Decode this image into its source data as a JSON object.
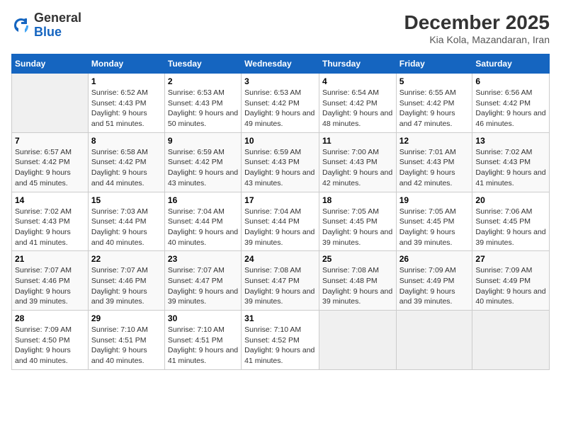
{
  "header": {
    "logo_general": "General",
    "logo_blue": "Blue",
    "title": "December 2025",
    "subtitle": "Kia Kola, Mazandaran, Iran"
  },
  "weekdays": [
    "Sunday",
    "Monday",
    "Tuesday",
    "Wednesday",
    "Thursday",
    "Friday",
    "Saturday"
  ],
  "weeks": [
    [
      {
        "num": "",
        "sunrise": "",
        "sunset": "",
        "daylight": ""
      },
      {
        "num": "1",
        "sunrise": "Sunrise: 6:52 AM",
        "sunset": "Sunset: 4:43 PM",
        "daylight": "Daylight: 9 hours and 51 minutes."
      },
      {
        "num": "2",
        "sunrise": "Sunrise: 6:53 AM",
        "sunset": "Sunset: 4:43 PM",
        "daylight": "Daylight: 9 hours and 50 minutes."
      },
      {
        "num": "3",
        "sunrise": "Sunrise: 6:53 AM",
        "sunset": "Sunset: 4:42 PM",
        "daylight": "Daylight: 9 hours and 49 minutes."
      },
      {
        "num": "4",
        "sunrise": "Sunrise: 6:54 AM",
        "sunset": "Sunset: 4:42 PM",
        "daylight": "Daylight: 9 hours and 48 minutes."
      },
      {
        "num": "5",
        "sunrise": "Sunrise: 6:55 AM",
        "sunset": "Sunset: 4:42 PM",
        "daylight": "Daylight: 9 hours and 47 minutes."
      },
      {
        "num": "6",
        "sunrise": "Sunrise: 6:56 AM",
        "sunset": "Sunset: 4:42 PM",
        "daylight": "Daylight: 9 hours and 46 minutes."
      }
    ],
    [
      {
        "num": "7",
        "sunrise": "Sunrise: 6:57 AM",
        "sunset": "Sunset: 4:42 PM",
        "daylight": "Daylight: 9 hours and 45 minutes."
      },
      {
        "num": "8",
        "sunrise": "Sunrise: 6:58 AM",
        "sunset": "Sunset: 4:42 PM",
        "daylight": "Daylight: 9 hours and 44 minutes."
      },
      {
        "num": "9",
        "sunrise": "Sunrise: 6:59 AM",
        "sunset": "Sunset: 4:42 PM",
        "daylight": "Daylight: 9 hours and 43 minutes."
      },
      {
        "num": "10",
        "sunrise": "Sunrise: 6:59 AM",
        "sunset": "Sunset: 4:43 PM",
        "daylight": "Daylight: 9 hours and 43 minutes."
      },
      {
        "num": "11",
        "sunrise": "Sunrise: 7:00 AM",
        "sunset": "Sunset: 4:43 PM",
        "daylight": "Daylight: 9 hours and 42 minutes."
      },
      {
        "num": "12",
        "sunrise": "Sunrise: 7:01 AM",
        "sunset": "Sunset: 4:43 PM",
        "daylight": "Daylight: 9 hours and 42 minutes."
      },
      {
        "num": "13",
        "sunrise": "Sunrise: 7:02 AM",
        "sunset": "Sunset: 4:43 PM",
        "daylight": "Daylight: 9 hours and 41 minutes."
      }
    ],
    [
      {
        "num": "14",
        "sunrise": "Sunrise: 7:02 AM",
        "sunset": "Sunset: 4:43 PM",
        "daylight": "Daylight: 9 hours and 41 minutes."
      },
      {
        "num": "15",
        "sunrise": "Sunrise: 7:03 AM",
        "sunset": "Sunset: 4:44 PM",
        "daylight": "Daylight: 9 hours and 40 minutes."
      },
      {
        "num": "16",
        "sunrise": "Sunrise: 7:04 AM",
        "sunset": "Sunset: 4:44 PM",
        "daylight": "Daylight: 9 hours and 40 minutes."
      },
      {
        "num": "17",
        "sunrise": "Sunrise: 7:04 AM",
        "sunset": "Sunset: 4:44 PM",
        "daylight": "Daylight: 9 hours and 39 minutes."
      },
      {
        "num": "18",
        "sunrise": "Sunrise: 7:05 AM",
        "sunset": "Sunset: 4:45 PM",
        "daylight": "Daylight: 9 hours and 39 minutes."
      },
      {
        "num": "19",
        "sunrise": "Sunrise: 7:05 AM",
        "sunset": "Sunset: 4:45 PM",
        "daylight": "Daylight: 9 hours and 39 minutes."
      },
      {
        "num": "20",
        "sunrise": "Sunrise: 7:06 AM",
        "sunset": "Sunset: 4:45 PM",
        "daylight": "Daylight: 9 hours and 39 minutes."
      }
    ],
    [
      {
        "num": "21",
        "sunrise": "Sunrise: 7:07 AM",
        "sunset": "Sunset: 4:46 PM",
        "daylight": "Daylight: 9 hours and 39 minutes."
      },
      {
        "num": "22",
        "sunrise": "Sunrise: 7:07 AM",
        "sunset": "Sunset: 4:46 PM",
        "daylight": "Daylight: 9 hours and 39 minutes."
      },
      {
        "num": "23",
        "sunrise": "Sunrise: 7:07 AM",
        "sunset": "Sunset: 4:47 PM",
        "daylight": "Daylight: 9 hours and 39 minutes."
      },
      {
        "num": "24",
        "sunrise": "Sunrise: 7:08 AM",
        "sunset": "Sunset: 4:47 PM",
        "daylight": "Daylight: 9 hours and 39 minutes."
      },
      {
        "num": "25",
        "sunrise": "Sunrise: 7:08 AM",
        "sunset": "Sunset: 4:48 PM",
        "daylight": "Daylight: 9 hours and 39 minutes."
      },
      {
        "num": "26",
        "sunrise": "Sunrise: 7:09 AM",
        "sunset": "Sunset: 4:49 PM",
        "daylight": "Daylight: 9 hours and 39 minutes."
      },
      {
        "num": "27",
        "sunrise": "Sunrise: 7:09 AM",
        "sunset": "Sunset: 4:49 PM",
        "daylight": "Daylight: 9 hours and 40 minutes."
      }
    ],
    [
      {
        "num": "28",
        "sunrise": "Sunrise: 7:09 AM",
        "sunset": "Sunset: 4:50 PM",
        "daylight": "Daylight: 9 hours and 40 minutes."
      },
      {
        "num": "29",
        "sunrise": "Sunrise: 7:10 AM",
        "sunset": "Sunset: 4:51 PM",
        "daylight": "Daylight: 9 hours and 40 minutes."
      },
      {
        "num": "30",
        "sunrise": "Sunrise: 7:10 AM",
        "sunset": "Sunset: 4:51 PM",
        "daylight": "Daylight: 9 hours and 41 minutes."
      },
      {
        "num": "31",
        "sunrise": "Sunrise: 7:10 AM",
        "sunset": "Sunset: 4:52 PM",
        "daylight": "Daylight: 9 hours and 41 minutes."
      },
      {
        "num": "",
        "sunrise": "",
        "sunset": "",
        "daylight": ""
      },
      {
        "num": "",
        "sunrise": "",
        "sunset": "",
        "daylight": ""
      },
      {
        "num": "",
        "sunrise": "",
        "sunset": "",
        "daylight": ""
      }
    ]
  ]
}
